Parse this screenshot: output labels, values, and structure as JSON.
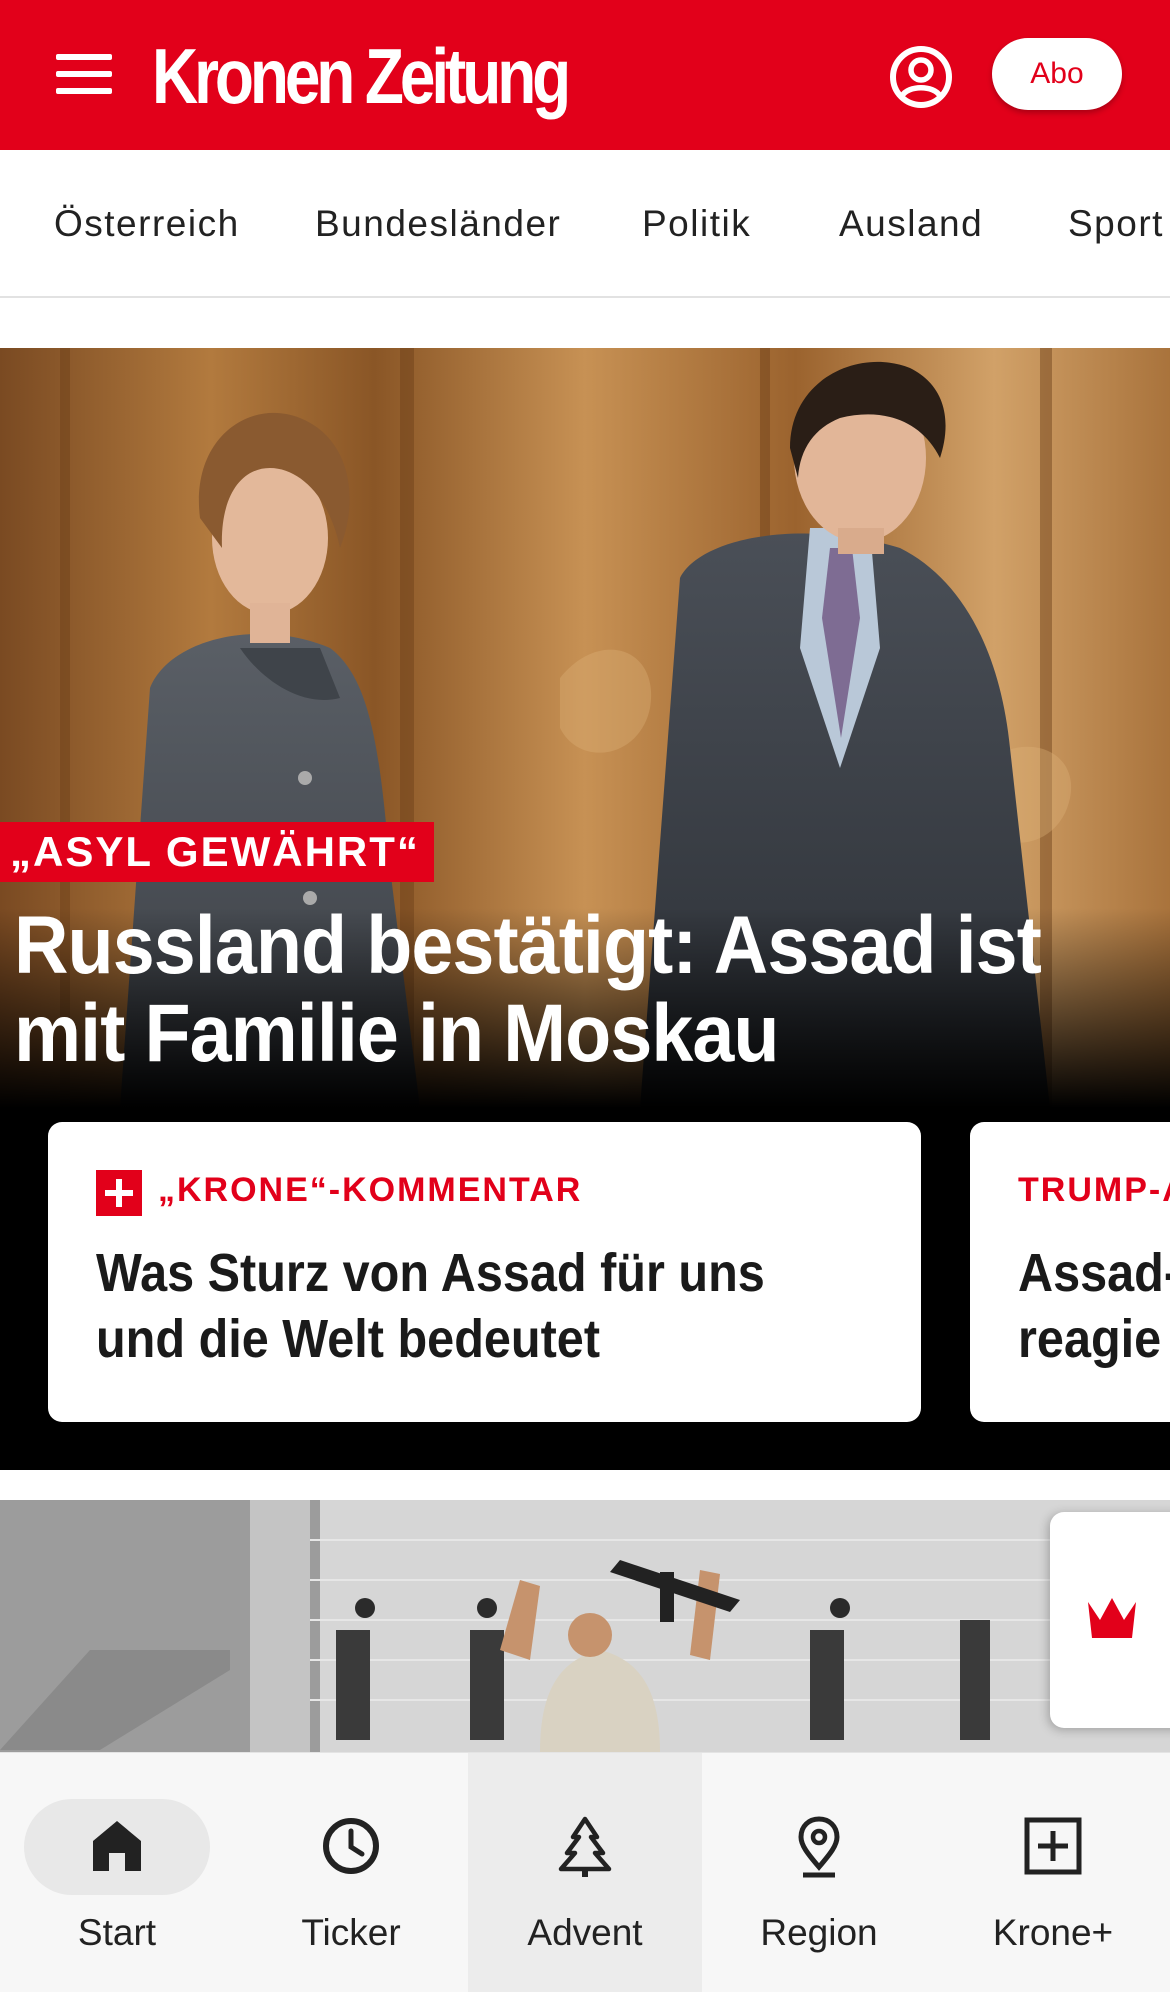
{
  "header": {
    "logo": "Kronen Zeitung",
    "abo_label": "Abo",
    "brand_color": "#e2001a"
  },
  "catnav": {
    "items": [
      {
        "label": "Österreich"
      },
      {
        "label": "Bundesländer"
      },
      {
        "label": "Politik"
      },
      {
        "label": "Ausland"
      },
      {
        "label": "Sport"
      }
    ]
  },
  "hero": {
    "kicker": "„ASYL GEWÄHRT“",
    "headline": "Russland bestätigt: Assad ist mit Familie in Moskau"
  },
  "cards": [
    {
      "kicker": "„KRONE“-KOMMENTAR",
      "title": "Was Sturz von Assad für uns und die Welt bedeutet"
    },
    {
      "kicker": "TRUMP-A",
      "title_line1": "Assad-",
      "title_line2": "reagie"
    }
  ],
  "bottom_nav": {
    "items": [
      {
        "label": "Start",
        "icon": "home-icon"
      },
      {
        "label": "Ticker",
        "icon": "clock-icon"
      },
      {
        "label": "Advent",
        "icon": "tree-icon"
      },
      {
        "label": "Region",
        "icon": "location-pin-icon"
      },
      {
        "label": "Krone+",
        "icon": "plus-box-icon"
      }
    ]
  }
}
